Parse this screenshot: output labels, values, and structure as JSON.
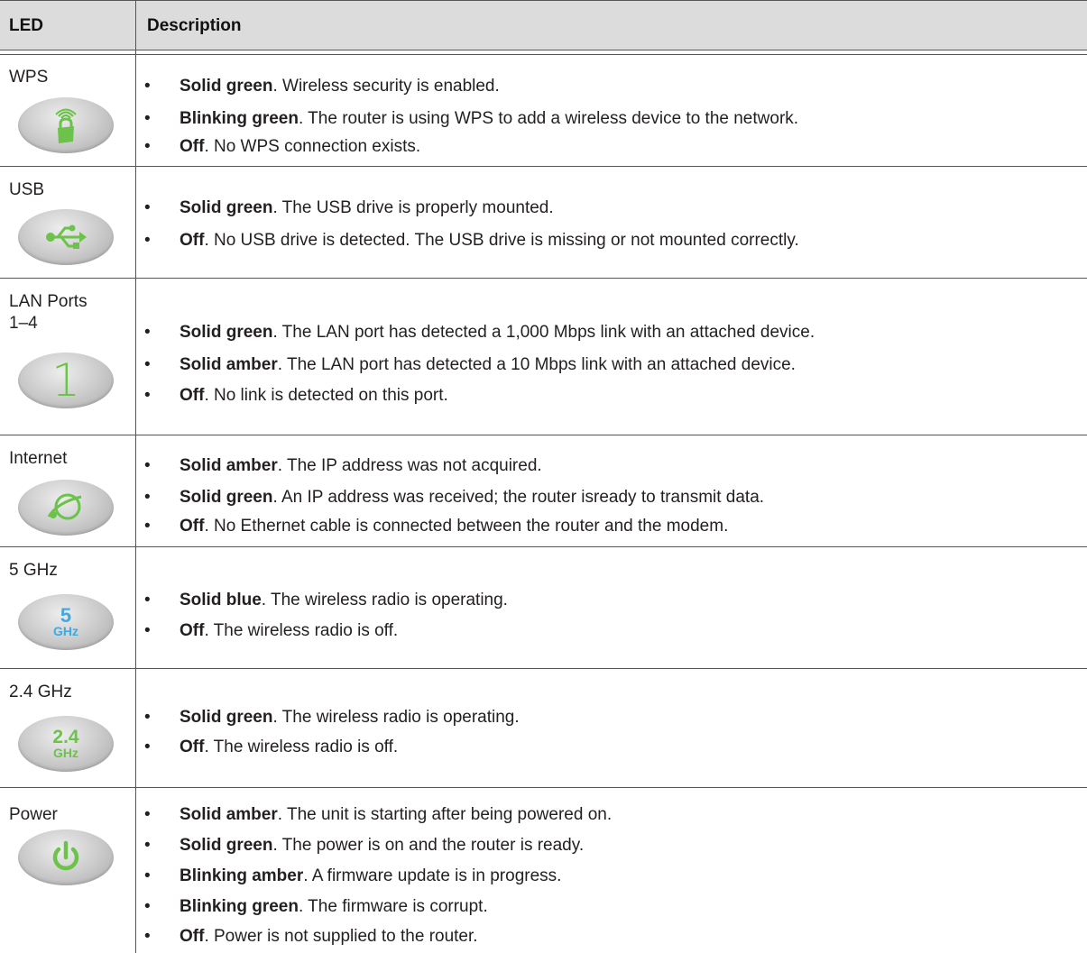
{
  "header": {
    "col1": "LED",
    "col2": "Description"
  },
  "colors": {
    "green": "#6cc24a",
    "blue": "#3fa9e0",
    "grid": "#555555",
    "header_bg": "#dcdcdc"
  },
  "rows": [
    {
      "name": "WPS",
      "icon": "wps-lock-icon",
      "items": [
        {
          "bold": "Solid green",
          "text": ". Wireless security is enabled."
        },
        {
          "bold": "Blinking green",
          "text": ". The router is using WPS to add a wireless device to the network."
        },
        {
          "bold": "Off",
          "text": ". No WPS connection exists."
        }
      ]
    },
    {
      "name": "USB",
      "icon": "usb-icon",
      "items": [
        {
          "bold": "Solid green",
          "text": ". The USB drive is properly mounted."
        },
        {
          "bold": "Off",
          "text": ". No USB drive is detected. The USB drive is missing or not mounted correctly."
        }
      ]
    },
    {
      "name": "LAN Ports\n1–4",
      "icon": "lan-port-one-icon",
      "icon_text": "1",
      "items": [
        {
          "bold": "Solid green",
          "text": ". The LAN port has detected a 1,000 Mbps link with an attached device."
        },
        {
          "bold": "Solid amber",
          "text": ". The LAN port has detected a 10 Mbps link with an attached device."
        },
        {
          "bold": "Off",
          "text": ". No link is detected on this port."
        }
      ]
    },
    {
      "name": "Internet",
      "icon": "internet-globe-icon",
      "items": [
        {
          "bold": "Solid amber",
          "text": ". The IP address was not acquired."
        },
        {
          "bold": "Solid green",
          "text": ". An IP address was received; the router isready to transmit data."
        },
        {
          "bold": "Off",
          "text": ". No Ethernet cable is connected between the router and the modem."
        }
      ]
    },
    {
      "name": "5 GHz",
      "icon": "five-ghz-icon",
      "icon_top": "5",
      "icon_bottom": "GHz",
      "items": [
        {
          "bold": "Solid blue",
          "text": ". The wireless radio is operating."
        },
        {
          "bold": "Off",
          "text": ". The wireless radio is off."
        }
      ]
    },
    {
      "name": "2.4 GHz",
      "icon": "two-point-four-ghz-icon",
      "icon_top": "2.4",
      "icon_bottom": "GHz",
      "items": [
        {
          "bold": "Solid green",
          "text": ". The wireless radio is operating."
        },
        {
          "bold": "Off",
          "text": ". The wireless radio is off."
        }
      ]
    },
    {
      "name": "Power",
      "icon": "power-icon",
      "items": [
        {
          "bold": "Solid amber",
          "text": ". The unit is starting after being powered on."
        },
        {
          "bold": "Solid green",
          "text": ". The power is on and the router is ready."
        },
        {
          "bold": "Blinking amber",
          "text": ". A firmware update is in progress."
        },
        {
          "bold": "Blinking green",
          "text": ". The firmware is corrupt."
        },
        {
          "bold": "Off",
          "text": ". Power is not supplied to the router."
        }
      ]
    }
  ]
}
